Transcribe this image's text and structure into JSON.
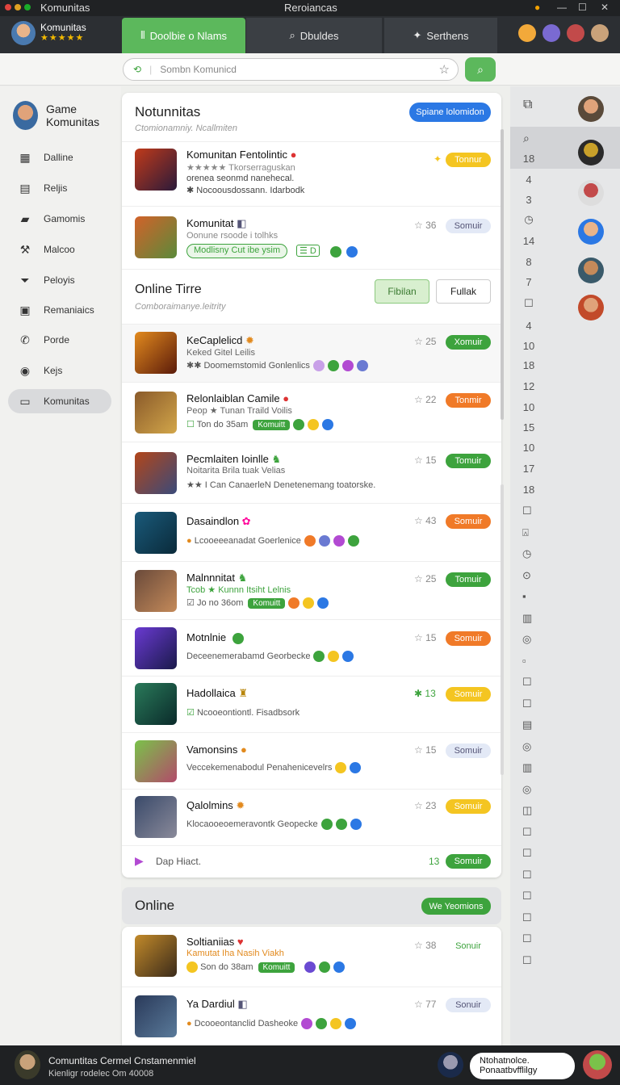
{
  "titlebar": {
    "app": "Komunitas",
    "center": "Reroiancas"
  },
  "profile": {
    "name": "Komunitas",
    "stars": "★★★★★"
  },
  "tabs": [
    {
      "label": "Doolbie o Nlams",
      "icon": "⦀"
    },
    {
      "label": "Dbuldes",
      "icon": "⌕"
    },
    {
      "label": "Serthens",
      "icon": "✦"
    }
  ],
  "search": {
    "placeholder": "Sombn Komunicd"
  },
  "nav": {
    "title": "Game Komunitas",
    "items": [
      {
        "label": "Dalline",
        "icon": "grid-icon"
      },
      {
        "label": "Reljis",
        "icon": "document-icon"
      },
      {
        "label": "Gamomis",
        "icon": "folder-icon"
      },
      {
        "label": "Malcoo",
        "icon": "wrench-icon"
      },
      {
        "label": "Peloyis",
        "icon": "funnel-icon"
      },
      {
        "label": "Remaniaics",
        "icon": "calendar-icon"
      },
      {
        "label": "Porde",
        "icon": "phone-icon"
      },
      {
        "label": "Kejs",
        "icon": "record-icon"
      },
      {
        "label": "Komunitas",
        "icon": "folder-icon"
      }
    ]
  },
  "panel": {
    "title": "Notunnitas",
    "subtitle": "Ctomionamniy. Ncallmiten",
    "button": "Spiane lolomidon"
  },
  "featured": [
    {
      "title": "Komunitan Fentolintic",
      "sub1": "★★★★★ Tkorserraguskan",
      "sub2": "orenea seonmd nanehecal.",
      "sub3": "✱ Nocoousdossann. Idarbodk",
      "count": "",
      "btn": "Tonnur",
      "btn_color": "yellow",
      "thumb": [
        "#c03a1a",
        "#2a1a3a"
      ]
    },
    {
      "title": "Komunitat",
      "sub1": "Oonune rsoode i tolhks",
      "sub2": "Modlisny Cut ibe ysim",
      "sub3": "",
      "count": "☆ 36",
      "btn": "Somuir",
      "btn_color": "light",
      "thumb": [
        "#d2622a",
        "#5a8a3a"
      ]
    }
  ],
  "online": {
    "title": "Online Tirre",
    "subtitle": "Comboraimanye.leitrity",
    "filter1": "Fibilan",
    "filter2": "Fullak"
  },
  "rows": [
    {
      "title": "KeCaplelicd",
      "sub": "Keked Gitel Leilis",
      "sub2": "✱✱ Doomemstomid Gonlenlics",
      "count": "☆ 25",
      "btn": "Xomuir",
      "btn_color": "green",
      "thumb": [
        "#e28a1e",
        "#5a1a0a"
      ]
    },
    {
      "title": "Relonlaiblan Camile",
      "sub": "Peop ★ Tunan Traild Voilis",
      "sub2": "Ton do 35am",
      "count": "☆ 22",
      "btn": "Tonmir",
      "btn_color": "orange",
      "thumb": [
        "#8a5a2a",
        "#d2a64a"
      ]
    },
    {
      "title": "Pecmlaiten Ioinlle",
      "sub": "Noitarita Brila tuak Velias",
      "sub2": "★★ I Can CanaerleN Denetenemang toatorske.",
      "count": "☆ 15",
      "btn": "Tomuir",
      "btn_color": "green",
      "thumb": [
        "#b2461a",
        "#3a4a7a"
      ]
    },
    {
      "title": "Dasaindlon",
      "sub": "",
      "sub2": "Lcooeeeanadat Goerlenice",
      "count": "☆ 43",
      "btn": "Somuir",
      "btn_color": "orange",
      "thumb": [
        "#1a5a7a",
        "#0a2a3a"
      ]
    },
    {
      "title": "Malnnnitat",
      "sub": "Tcob ★ Kunnn Itsiht Lelnis",
      "sub2": "Jo no 36om",
      "count": "☆ 25",
      "btn": "Tomuir",
      "btn_color": "green",
      "thumb": [
        "#6a4a3a",
        "#c48a5a"
      ]
    },
    {
      "title": "Motnlnie",
      "sub": "",
      "sub2": "Deceenemerabamd Georbecke",
      "count": "☆ 15",
      "btn": "Somuir",
      "btn_color": "orange",
      "thumb": [
        "#6a3ad2",
        "#1a1a4a"
      ]
    },
    {
      "title": "Hadollaica",
      "sub": "",
      "sub2": "Ncooeontiontl. Fisadbsork",
      "count": "✱ 13",
      "btn": "Somuir",
      "btn_color": "yellow",
      "thumb": [
        "#2a7a5a",
        "#0a2a2a"
      ]
    },
    {
      "title": "Vamonsins",
      "sub": "",
      "sub2": "Veccekemenabodul Penahenicevelrs",
      "count": "☆ 15",
      "btn": "Somuir",
      "btn_color": "light",
      "thumb": [
        "#7ac24a",
        "#b24a6a"
      ]
    },
    {
      "title": "Qalolmins",
      "sub": "",
      "sub2": "Klocaooeoemeravontk Geopecke",
      "count": "☆ 23",
      "btn": "Somuir",
      "btn_color": "yellow",
      "thumb": [
        "#3a4a6a",
        "#8a8a9a"
      ]
    }
  ],
  "footer_row": {
    "label": "Dap Hiact.",
    "count": "13",
    "btn": "Somuir"
  },
  "online2": {
    "title": "Online",
    "button": "We Yeomions"
  },
  "rows2": [
    {
      "title": "Soltianiias",
      "sub": "Kamutat Iha Nasih Viakh",
      "sub2": "Son do 38am",
      "count": "☆ 38",
      "btn": "Sonuir",
      "btn_color": "none",
      "thumb": [
        "#c28a2a",
        "#3a2a1a"
      ]
    },
    {
      "title": "Ya Dardiul",
      "sub": "",
      "sub2": "Dcooeontanclid Dasheoke",
      "count": "☆ 77",
      "btn": "Sonuir",
      "btn_color": "light",
      "thumb": [
        "#2a3a5a",
        "#5a7a9a"
      ]
    }
  ],
  "right_numbers": [
    "18",
    "4",
    "3",
    "",
    "14",
    "8",
    "7",
    "",
    "4",
    "10",
    "18",
    "12",
    "10",
    "15",
    "10",
    "17",
    "18"
  ],
  "bottom": {
    "line1": "Comuntitas Cermel Cnstamenmiel",
    "line2": "Kienligr rodelec Om 40008",
    "bubble1": "Ntohatnolce.",
    "bubble2": "Ponaatbvfflilgy"
  },
  "colors": {
    "accent": "#5cb85c",
    "blue": "#2b78e4",
    "orange": "#f07a28",
    "yellow": "#f4c521"
  }
}
